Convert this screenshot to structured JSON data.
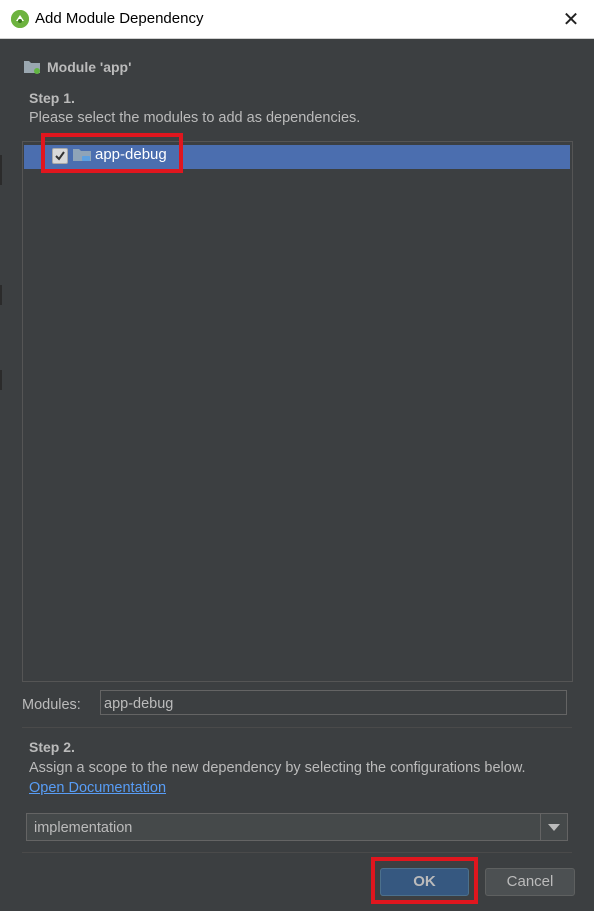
{
  "window": {
    "title": "Add Module Dependency",
    "close_glyph": "✕"
  },
  "module_header": {
    "label": "Module 'app'",
    "icon": "module-folder-icon"
  },
  "step1": {
    "title": "Step 1.",
    "description": "Please select the modules to add as dependencies."
  },
  "modules_list": [
    {
      "label": "app-debug",
      "checked": true,
      "selected": true,
      "icon": "module-folder-icon"
    }
  ],
  "modules_field": {
    "label": "Modules:",
    "value": "app-debug"
  },
  "step2": {
    "title": "Step 2.",
    "description": "Assign a scope to the new dependency by selecting the configurations below.",
    "link": "Open Documentation"
  },
  "scope_select": {
    "value": "implementation"
  },
  "buttons": {
    "ok": "OK",
    "cancel": "Cancel"
  },
  "colors": {
    "background": "#3c3f41",
    "selection": "#4b6eaf",
    "highlight": "#e0161e",
    "link": "#589df6"
  }
}
